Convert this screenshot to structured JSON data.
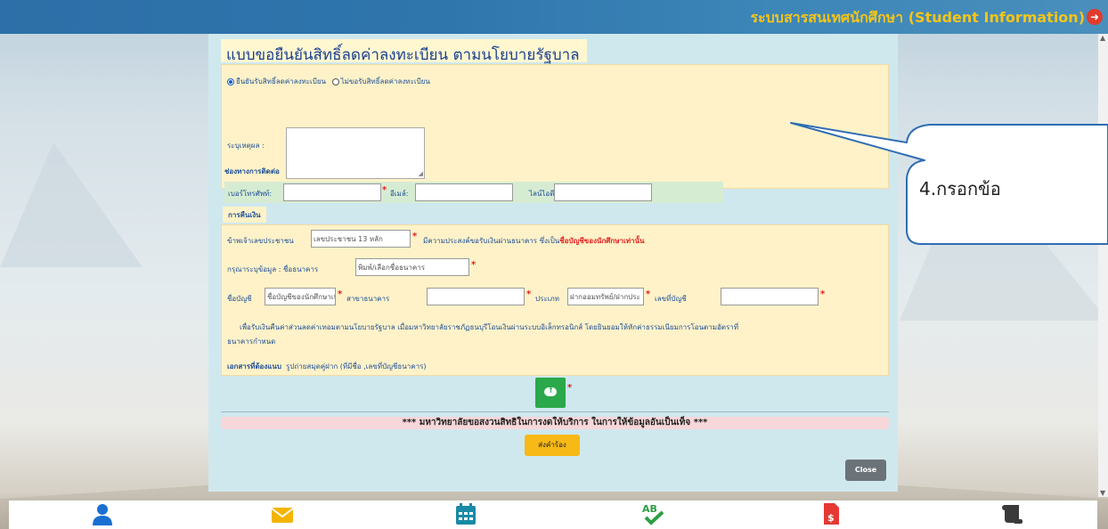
{
  "header": {
    "title": "ระบบสารสนเทศนักศึกษา (Student Information)"
  },
  "modal": {
    "title": "แบบขอยืนยันสิทธิ์ลดค่าลงทะเบียน ตามนโยบายรัฐบาล",
    "confirm": {
      "option_confirm": "ยืนยันรับสิทธิ์ลดค่าลงทะเบียน",
      "option_decline": "ไม่ขอรับสิทธิ์ลดค่าลงทะเบียน",
      "selected": "ยืนยันรับสิทธิ์ลดค่าลงทะเบียน",
      "reason_label": "ระบุเหตุผล :",
      "reason_value": ""
    },
    "contact": {
      "heading": "ช่องทางการติดต่อ",
      "phone_label": "เบอร์โทรศัพท์:",
      "phone_value": "",
      "email_label": "อีเมล์:",
      "email_value": "",
      "line_label": "ไลน์ไอดี:",
      "line_value": ""
    },
    "refund": {
      "tab_label": "การคืนเงิน",
      "id_prefix": "ข้าพเจ้าเลขประชาชน",
      "id_placeholder": "เลขประชาชน 13 หลัก",
      "id_suffix": "มีความประสงค์ขอรับเงินผ่านธนาคาร ซึ่งเป็น",
      "id_suffix_emphasis": "ชื่อบัญชีของนักศึกษาเท่านั้น",
      "bank_prompt": "กรุณาระบุข้อมูล : ชื่อธนาคาร",
      "bank_placeholder": "พิมพ์/เลือกชื่อธนาคาร",
      "account_name_label": "ชื่อบัญชี",
      "account_name_placeholder": "ชื่อบัญชีของนักศึกษาเท่า",
      "branch_label": "สาขาธนาคาร",
      "branch_value": "",
      "type_label": "ประเภท",
      "type_placeholder": "ฝากออมทรัพย์/ฝากประ",
      "account_no_label": "เลขที่บัญชี",
      "account_no_value": "",
      "note_line1": "เพื่อรับเงินคืนค่าส่วนลดค่าเทอมตามนโยบายรัฐบาล เมื่อมหาวิทยาลัยราชภัฏธนบุรีโอนเงินผ่านระบบอิเล็กทรอนิกส์ โดยยินยอมให้หักค่าธรรมเนียมการโอนตามอัตราที่",
      "note_line2": "ธนาคารกำหนด",
      "docs_label": "เอกสารที่ต้องแนบ",
      "docs_value": "รูปถ่ายสมุดคู่ฝาก (ที่มีชื่อ ,เลขที่บัญชีธนาคาร)"
    },
    "warning": "*** มหาวิทยาลัยขอสงวนสิทธิในการงดให้บริการ ในการให้ข้อมูลอันเป็นเท็จ ***",
    "submit_label": "ส่งคำร้อง",
    "close_label": "Close",
    "required_mark": "*"
  },
  "callout": {
    "text": "4.กรอกข้อ"
  },
  "colors": {
    "header_bg": "#2f76ad",
    "header_title": "#f5c518",
    "modal_bg": "#cfe8ee",
    "panel_bg": "#fff2c8",
    "contact_bg": "#d6ecd2",
    "required": "#e02020",
    "upload_btn": "#2ba84a",
    "submit_btn": "#f7b915",
    "close_btn": "#6b7379"
  },
  "bottom_nav": [
    {
      "icon": "user-icon",
      "color": "#1b6fd1"
    },
    {
      "icon": "envelope-icon",
      "color": "#f4b400"
    },
    {
      "icon": "calendar-icon",
      "color": "#1a8aa6"
    },
    {
      "icon": "spellcheck-icon",
      "color": "#2e9e44"
    },
    {
      "icon": "invoice-dollar-icon",
      "color": "#e53935"
    },
    {
      "icon": "scroll-icon",
      "color": "#3a3a3a"
    }
  ]
}
